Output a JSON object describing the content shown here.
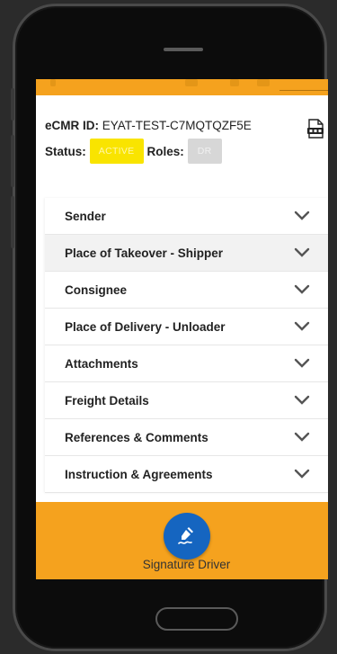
{
  "document": {
    "id_label": "eCMR ID:",
    "id_value": "EYAT-TEST-C7MQTQZF5E",
    "status_label": "Status:",
    "status_badge": "ACTIVE",
    "roles_label": "Roles:",
    "roles_badge": "DR"
  },
  "sections": [
    {
      "label": "Sender"
    },
    {
      "label": "Place of Takeover - Shipper"
    },
    {
      "label": "Consignee"
    },
    {
      "label": "Place of Delivery - Unloader"
    },
    {
      "label": "Attachments"
    },
    {
      "label": "Freight Details"
    },
    {
      "label": "References & Comments"
    },
    {
      "label": "Instruction & Agreements"
    }
  ],
  "footer": {
    "signature_label": "Signature Driver"
  },
  "colors": {
    "accent": "#f5a21e",
    "active_badge": "#f9e400",
    "role_badge": "#d7d7d7",
    "fab": "#1565c0"
  }
}
